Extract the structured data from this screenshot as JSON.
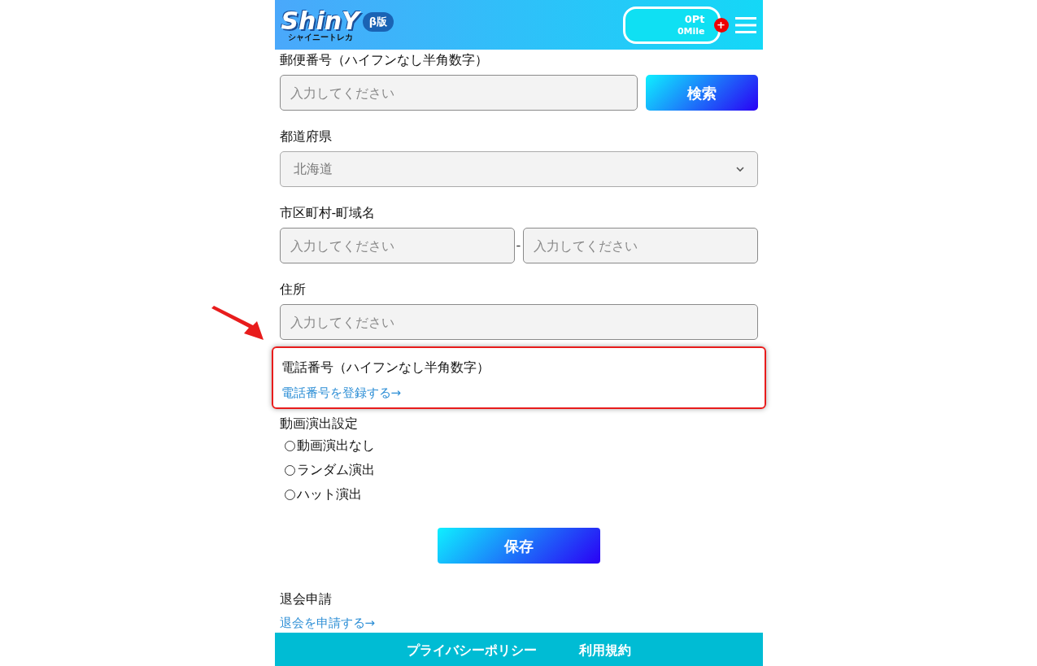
{
  "header": {
    "logo": "ShinY",
    "logo_sub": "シャイニートレカ",
    "beta_badge": "β版",
    "points": "0Pt",
    "miles": "0Mile",
    "add_badge": "+"
  },
  "postal": {
    "label": "郵便番号（ハイフンなし半角数字）",
    "placeholder": "入力してください",
    "button": "検索"
  },
  "prefecture": {
    "label": "都道府県",
    "value": "北海道"
  },
  "city": {
    "label": "市区町村-町域名",
    "placeholder_1": "入力してください",
    "separator": "-",
    "placeholder_2": "入力してください"
  },
  "address": {
    "label": "住所",
    "placeholder": "入力してください"
  },
  "phone": {
    "label": "電話番号（ハイフンなし半角数字）",
    "link": "電話番号を登録する→",
    "highlighted": true
  },
  "video": {
    "label": "動画演出設定",
    "options": [
      {
        "label": "動画演出なし",
        "selected": false
      },
      {
        "label": "ランダム演出",
        "selected": false
      },
      {
        "label": "ハット演出",
        "selected": false
      }
    ]
  },
  "save_button": "保存",
  "withdraw": {
    "label": "退会申請",
    "link": "退会を申請する→"
  },
  "footer": {
    "links": [
      "プライバシーポリシー",
      "利用規約"
    ]
  }
}
